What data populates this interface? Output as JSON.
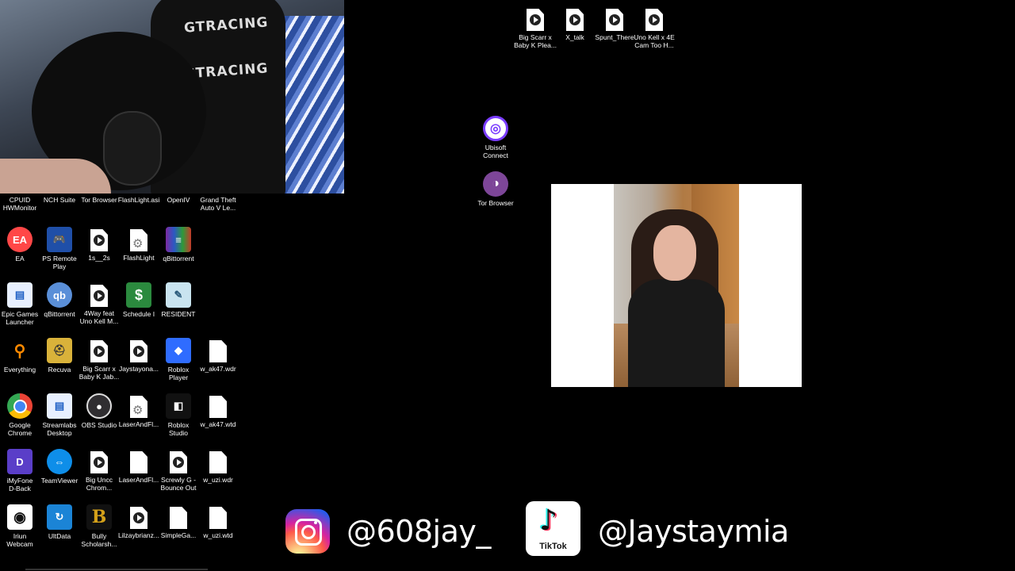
{
  "webcam": {
    "chair_brand": "GTRACING"
  },
  "desktop_top": [
    {
      "label": "Big Scarr x\nBaby K Plea...",
      "type": "media"
    },
    {
      "label": "X_talk",
      "type": "media"
    },
    {
      "label": "Spunt_There",
      "type": "media"
    },
    {
      "label": "Uno Kell x 4E\nCam Too H...",
      "type": "media"
    }
  ],
  "desktop_middle": [
    {
      "label": "Ubisoft\nConnect",
      "icon": "ubisoft-icon"
    },
    {
      "label": "Tor Browser",
      "icon": "tor-browser-icon"
    }
  ],
  "desktop_left": {
    "row1": [
      "CPUID\nHWMonitor",
      "NCH Suite",
      "Tor Browser",
      "FlashLight.asi",
      "OpenIV",
      "Grand Theft\nAuto V Le..."
    ],
    "row2": [
      "EA",
      "PS Remote\nPlay",
      "1s__2s",
      "FlashLight",
      "qBittorrent"
    ],
    "row3": [
      "Epic Games\nLauncher",
      "qBittorrent",
      "4Way feat\nUno Kell M...",
      "Schedule I",
      "RESIDENT"
    ],
    "row4": [
      "Everything",
      "Recuva",
      "Big Scarr x\nBaby K Jab...",
      "Jaystayona...",
      "Roblox\nPlayer",
      "w_ak47.wdr"
    ],
    "row5": [
      "Google\nChrome",
      "Streamlabs\nDesktop",
      "OBS Studio",
      "LaserAndFl...",
      "Roblox\nStudio",
      "w_ak47.wtd"
    ],
    "row6": [
      "iMyFone\nD-Back",
      "TeamViewer",
      "Big Uncc\nChrom...",
      "LaserAndFl...",
      "Screwly G -\nBounce Out",
      "w_uzi.wdr"
    ],
    "row7": [
      "Iriun\nWebcam",
      "UltData",
      "Bully\nScholarsh...",
      "Lilzaybrianz...",
      "SimpleGa...",
      "w_uzi.wtd"
    ]
  },
  "social": {
    "instagram_handle": "@608jay_",
    "tiktok_handle": "@Jaystaymia",
    "tiktok_logo_text": "TikTok"
  },
  "colors": {
    "instagram_gradient": [
      "#feda75",
      "#d62976",
      "#962fbf",
      "#4f5bd5"
    ],
    "ubisoft": "#7a3cff",
    "tor": "#7d4698",
    "ea": "#ff4747",
    "roblox": "#2f6cff"
  }
}
